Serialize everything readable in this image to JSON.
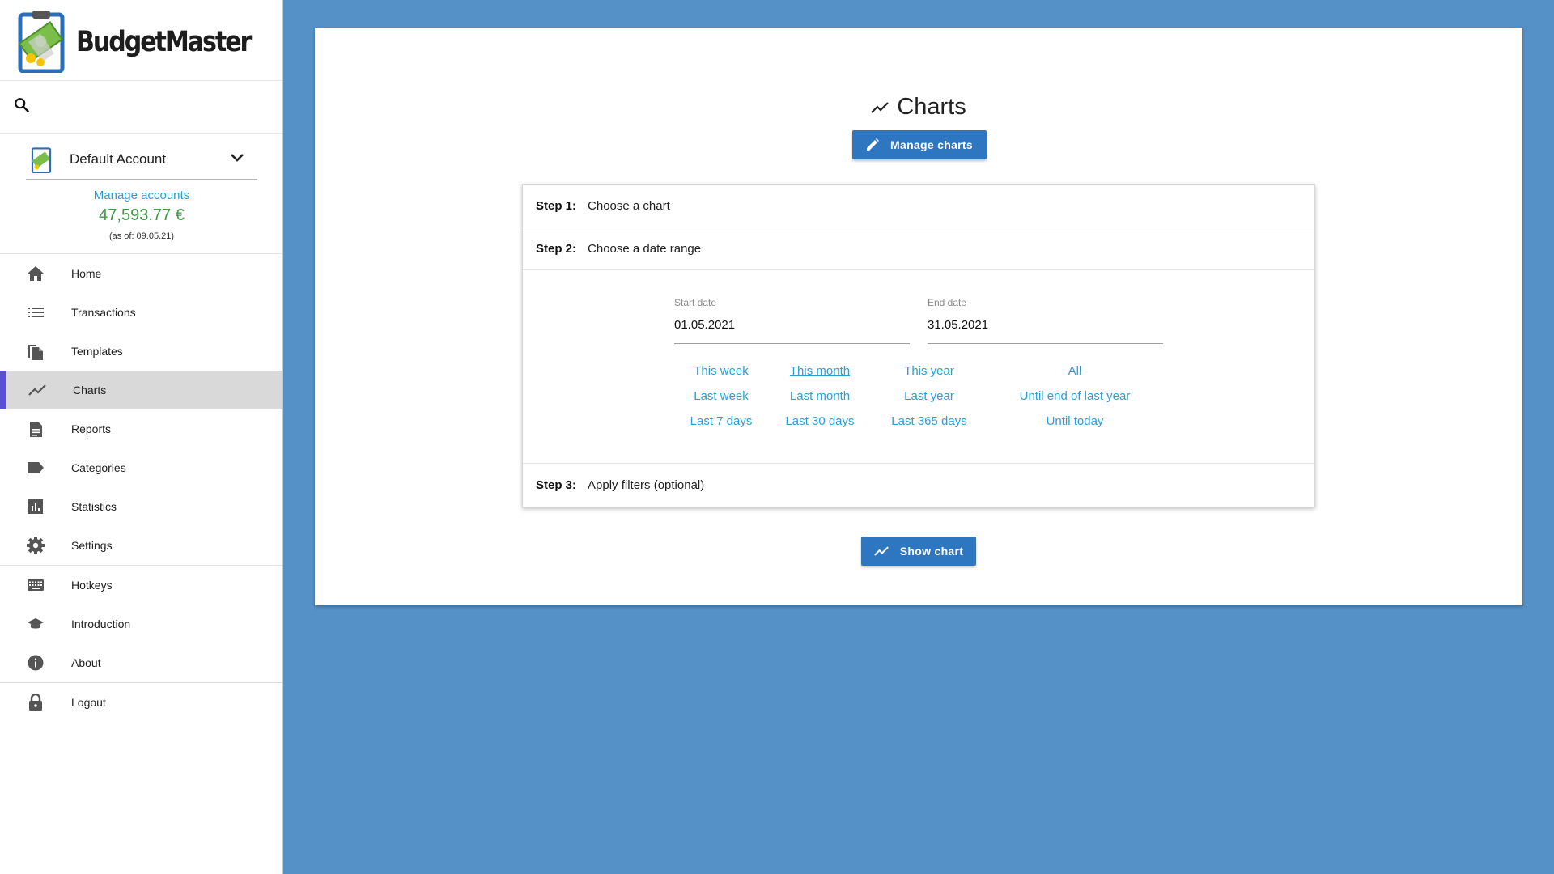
{
  "app": {
    "name": "BudgetMaster",
    "colors": {
      "accent": "#2e77c0",
      "link": "#2a9fd6",
      "balance": "#3d9a46",
      "background": "#5591c7",
      "active_indicator": "#5b4fd4"
    }
  },
  "sidebar": {
    "search_icon": "search-icon",
    "account": {
      "name": "Default Account",
      "manage_label": "Manage accounts",
      "balance": "47,593.77 €",
      "balance_date": "(as of: 09.05.21)"
    },
    "nav": [
      {
        "label": "Home",
        "icon": "home-icon"
      },
      {
        "label": "Transactions",
        "icon": "list-icon"
      },
      {
        "label": "Templates",
        "icon": "file-copy-icon"
      },
      {
        "label": "Charts",
        "icon": "chart-line-icon",
        "active": true
      },
      {
        "label": "Reports",
        "icon": "document-icon"
      },
      {
        "label": "Categories",
        "icon": "label-icon"
      },
      {
        "label": "Statistics",
        "icon": "bar-chart-icon"
      },
      {
        "label": "Settings",
        "icon": "gear-icon"
      }
    ],
    "nav_secondary": [
      {
        "label": "Hotkeys",
        "icon": "keyboard-icon"
      },
      {
        "label": "Introduction",
        "icon": "school-icon"
      },
      {
        "label": "About",
        "icon": "info-icon"
      }
    ],
    "logout": {
      "label": "Logout",
      "icon": "lock-icon"
    }
  },
  "main": {
    "title": "Charts",
    "manage_button": "Manage charts",
    "steps": {
      "step1": {
        "num": "Step 1:",
        "text": "Choose a chart"
      },
      "step2": {
        "num": "Step 2:",
        "text": "Choose a date range"
      },
      "step3": {
        "num": "Step 3:",
        "text": "Apply filters (optional)"
      }
    },
    "start_date": {
      "label": "Start date",
      "value": "01.05.2021"
    },
    "end_date": {
      "label": "End date",
      "value": "31.05.2021"
    },
    "quick_ranges": {
      "this_week": "This week",
      "this_month": "This month",
      "this_year": "This year",
      "all": "All",
      "last_week": "Last week",
      "last_month": "Last month",
      "last_year": "Last year",
      "until_end_last_year": "Until end of last year",
      "last_7_days": "Last 7 days",
      "last_30_days": "Last 30 days",
      "last_365_days": "Last 365 days",
      "until_today": "Until today"
    },
    "show_button": "Show chart"
  }
}
